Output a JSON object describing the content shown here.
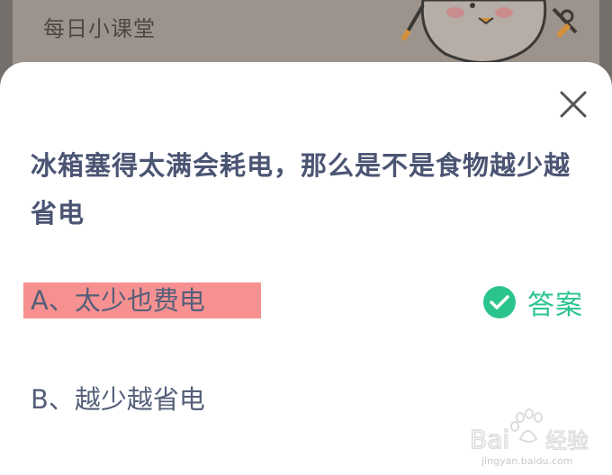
{
  "background": {
    "title": "每日小课堂"
  },
  "sheet": {
    "question": "冰箱塞得太满会耗电，那么是不是食物越少越省电",
    "options": [
      {
        "label": "A、太少也费电",
        "highlighted": true
      },
      {
        "label": "B、越少越省电",
        "highlighted": false
      }
    ],
    "answer_label": "答案",
    "close_icon": "close-icon",
    "check_icon": "check-circle-icon"
  },
  "watermark": {
    "brand": "Baidu经验",
    "url": "jingyan.baidu.com"
  },
  "colors": {
    "accent_green": "#2bc48d",
    "highlight_red": "#f79191",
    "question_text": "#4b5573"
  }
}
